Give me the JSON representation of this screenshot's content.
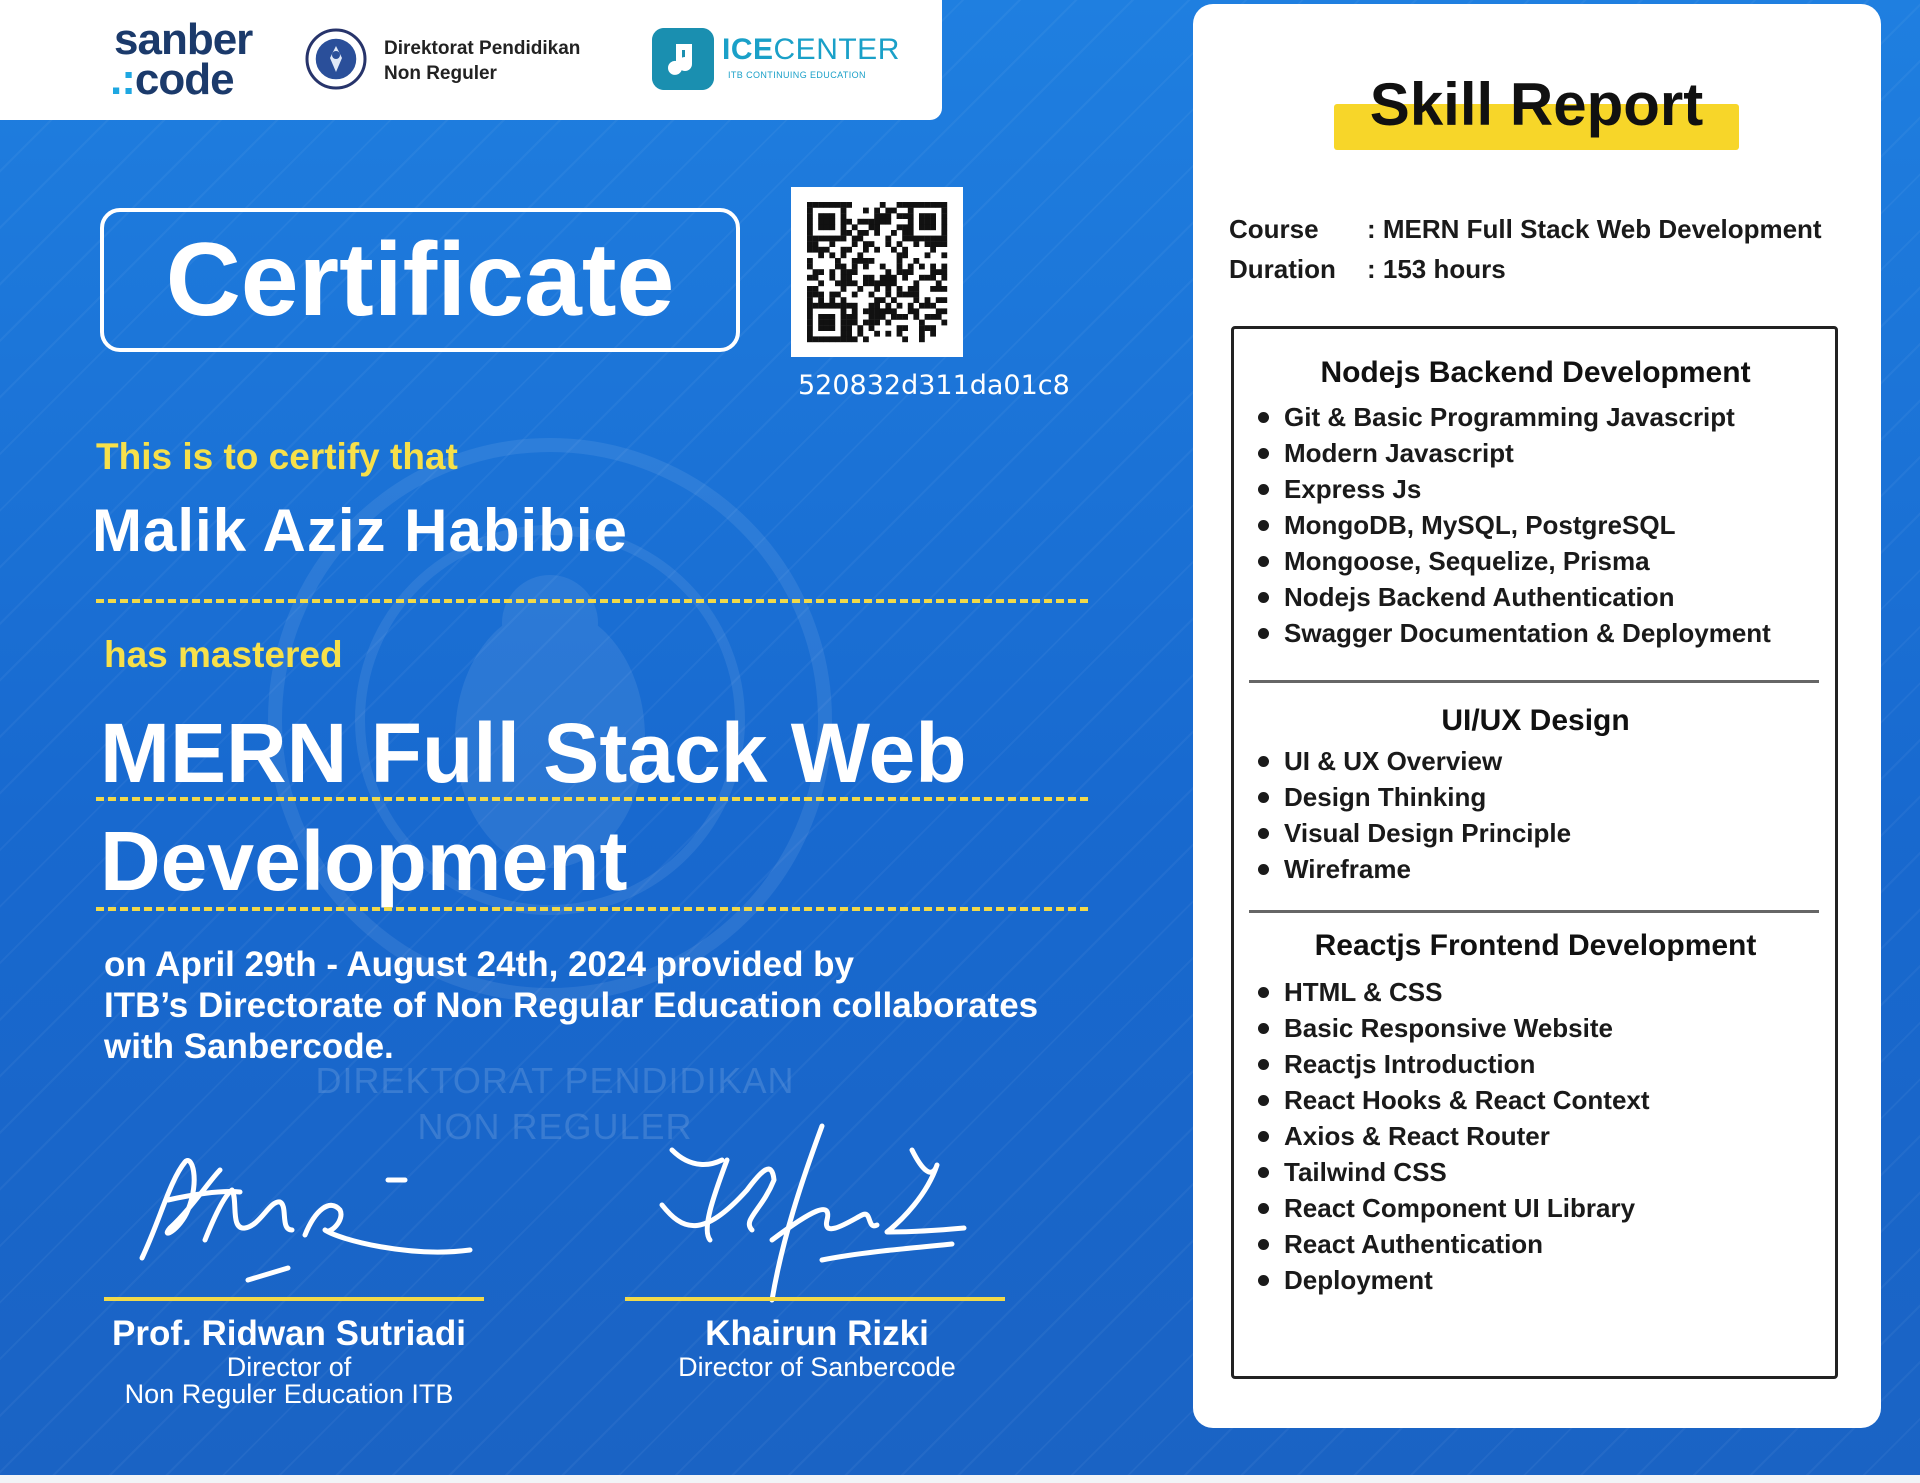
{
  "logos": {
    "sanber_line1": "sanber",
    "sanber_line2_dots": ".:",
    "sanber_line2_text": "code",
    "ditpen_line1": "Direktorat Pendidikan",
    "ditpen_line2": "Non Reguler",
    "ice_title_bold": "ICE",
    "ice_title_rest": "CENTER",
    "ice_subtitle": "ITB CONTINUING EDUCATION"
  },
  "certificate": {
    "title": "Certificate",
    "qr_code_id": "520832d311da01c8",
    "certify_text": "This is to certify that",
    "recipient": "Malik Aziz Habibie",
    "mastered_text": "has mastered",
    "course_line1": "MERN Full Stack Web",
    "course_line2": "Development",
    "desc_line1": "on April 29th - August 24th, 2024 provided by",
    "desc_line2": "ITB’s Directorate of Non Regular Education collaborates",
    "desc_line3": "with Sanbercode.",
    "watermark_line1": "DIREKTORAT PENDIDIKAN",
    "watermark_line2": "NON REGULER"
  },
  "signatories": [
    {
      "name": "Prof. Ridwan Sutriadi",
      "role_line1": "Director of",
      "role_line2": "Non Reguler Education ITB"
    },
    {
      "name": "Khairun Rizki",
      "role_line1": "Director of Sanbercode",
      "role_line2": ""
    }
  ],
  "skill_report": {
    "title": "Skill Report",
    "course_label": "Course",
    "course_value": ":  MERN Full Stack Web Development",
    "duration_label": "Duration",
    "duration_value": ":  153 hours",
    "sections": [
      {
        "title": "Nodejs Backend Development",
        "items": [
          "Git & Basic Programming Javascript",
          "Modern Javascript",
          "Express Js",
          "MongoDB, MySQL, PostgreSQL",
          "Mongoose, Sequelize, Prisma",
          "Nodejs Backend Authentication",
          "Swagger Documentation & Deployment"
        ]
      },
      {
        "title": "UI/UX Design",
        "items": [
          "UI & UX Overview",
          "Design Thinking",
          "Visual Design Principle",
          "Wireframe"
        ]
      },
      {
        "title": "Reactjs Frontend Development",
        "items": [
          "HTML & CSS",
          "Basic Responsive Website",
          "Reactjs Introduction",
          "React Hooks & React Context",
          "Axios & React Router",
          "Tailwind CSS",
          "React Component UI Library",
          "React Authentication",
          "Deployment"
        ]
      }
    ]
  },
  "colors": {
    "background": "#1f7fe0",
    "accent_yellow": "#f7e04a",
    "highlight_yellow": "#f7d629",
    "ice_teal": "#1aa0c8",
    "sanber_navy": "#1b3a6b"
  }
}
